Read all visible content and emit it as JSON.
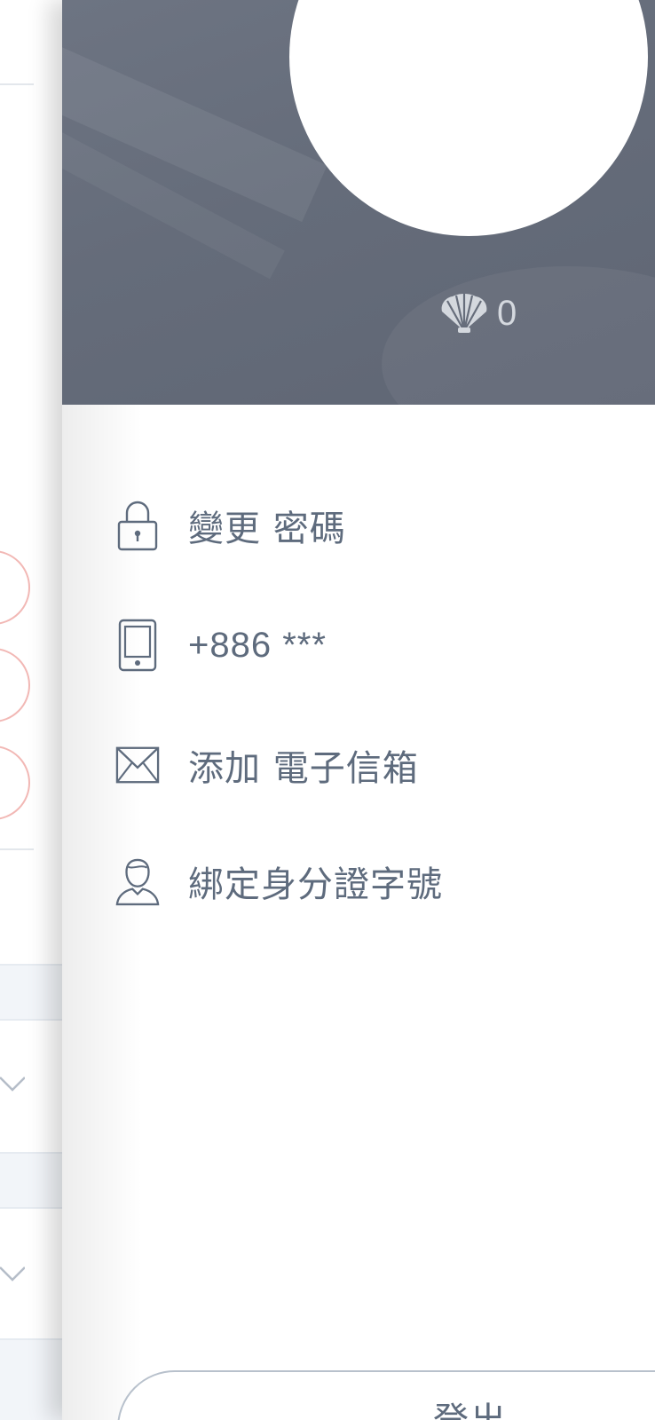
{
  "profile": {
    "points_value": "0",
    "points_icon": "shell-icon"
  },
  "menu": {
    "items": [
      {
        "label": "變更 密碼",
        "icon": "lock-icon"
      },
      {
        "label": "+886 ***",
        "icon": "phone-icon"
      },
      {
        "label": "添加 電子信箱",
        "icon": "mail-icon"
      },
      {
        "label": "綁定身分證字號",
        "icon": "user-icon"
      }
    ]
  },
  "logout": {
    "label": "登出"
  },
  "colors": {
    "header_bg": "#666d7b",
    "menu_text": "#5e6b7d",
    "icon_stroke": "#5e6b7d",
    "background_circle_border": "#f2b8b5"
  }
}
